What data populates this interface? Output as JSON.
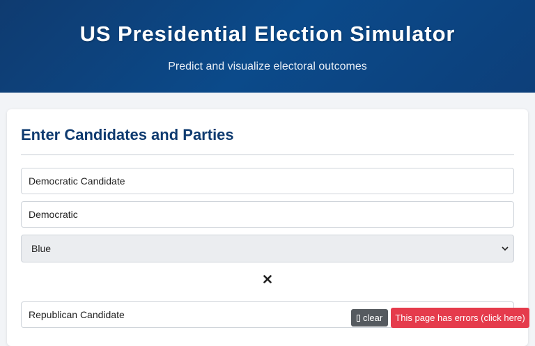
{
  "header": {
    "title": "US Presidential Election Simulator",
    "subtitle": "Predict and visualize electoral outcomes"
  },
  "section": {
    "title": "Enter Candidates and Parties"
  },
  "candidates": [
    {
      "name_value": "Democratic Candidate",
      "party_value": "Democratic",
      "color_selected": "Blue"
    },
    {
      "name_value": "Republican Candidate"
    }
  ],
  "remove_icon": "close-icon",
  "debug": {
    "clear_label": "clear",
    "error_text": "This page has errors (click here)"
  },
  "colors": {
    "header_bg": "#0f3b70",
    "accent": "#0f3b70",
    "error": "#e53b4c"
  }
}
